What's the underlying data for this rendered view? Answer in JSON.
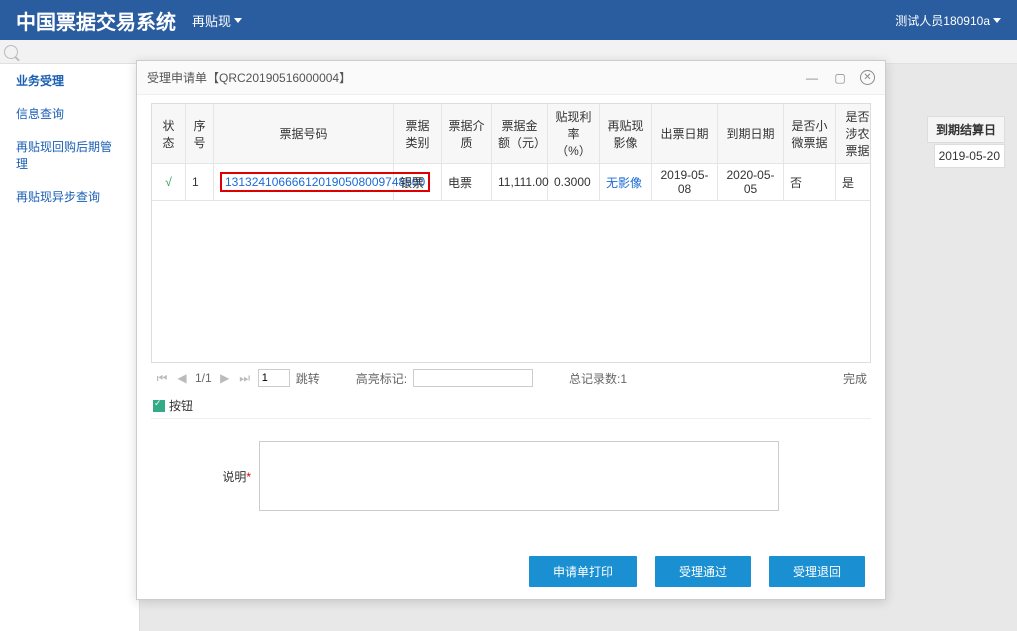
{
  "header": {
    "title": "中国票据交易系统",
    "sub": "再贴现",
    "user": "测试人员180910a"
  },
  "sidebar": {
    "items": [
      {
        "label": "业务受理",
        "active": true
      },
      {
        "label": "信息查询",
        "active": false
      },
      {
        "label": "再贴现回购后期管理",
        "active": false
      },
      {
        "label": "再贴现异步查询",
        "active": false
      }
    ]
  },
  "bg": {
    "col_header": "到期结算日",
    "cell_value": "2019-05-20"
  },
  "dialog": {
    "title": "受理申请单【QRC20190516000004】",
    "table": {
      "headers": [
        "状态",
        "序号",
        "票据号码",
        "票据类别",
        "票据介质",
        "票据金额（元）",
        "贴现利率（%）",
        "再贴现影像",
        "出票日期",
        "到期日期",
        "是否小微票据",
        "是否涉农票据"
      ],
      "row": {
        "status": "√",
        "seq": "1",
        "billno": "131324106666120190508009748500",
        "cat": "银票",
        "media": "电票",
        "amt": "11,111.00",
        "rate": "0.3000",
        "img": "无影像",
        "date1": "2019-05-08",
        "date2": "2020-05-05",
        "small": "否",
        "last": "是"
      }
    },
    "pager": {
      "page_info": "1/1",
      "page_input": "1",
      "jump": "跳转",
      "highlight_label": "高亮标记:",
      "total": "总记录数:1",
      "status": "完成"
    },
    "section_btn": "按钮",
    "form": {
      "label": "说明",
      "value": ""
    },
    "buttons": {
      "print": "申请单打印",
      "pass": "受理通过",
      "reject": "受理退回"
    }
  }
}
